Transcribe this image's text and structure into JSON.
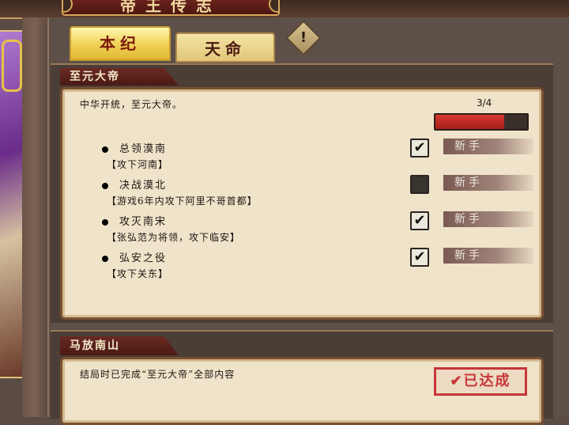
{
  "header": {
    "title": "帝王传志"
  },
  "tabs": [
    {
      "label": "本纪",
      "active": true
    },
    {
      "label": "天命",
      "active": false
    }
  ],
  "warning_icon": "exclamation-diamond-icon",
  "dynasty_section": {
    "title": "至元大帝",
    "description": "中华开统，至元大帝。",
    "progress": {
      "text": "3/4",
      "completed": 3,
      "total": 4
    },
    "tasks": [
      {
        "title": "总领漠南",
        "requirement": "【攻下河南】",
        "checked": true,
        "check_glyph": "✔",
        "badge": "新手"
      },
      {
        "title": "决战漠北",
        "requirement": "【游戏6年内攻下阿里不哥首都】",
        "checked": false,
        "check_glyph": "",
        "badge": "新手"
      },
      {
        "title": "攻灭南宋",
        "requirement": "【张弘范为将领，攻下临安】",
        "checked": true,
        "check_glyph": "✔",
        "badge": "新手"
      },
      {
        "title": "弘安之役",
        "requirement": "【攻下关东】",
        "checked": true,
        "check_glyph": "✔",
        "badge": "新手"
      }
    ]
  },
  "ending_section": {
    "title": "马放南山",
    "description": "结局时已完成“至元大帝”全部内容",
    "stamp": "✔已达成"
  },
  "colors": {
    "progress_fill": "#c0282a",
    "stamp": "#c8363a",
    "active_tab": "#f2d45a"
  }
}
